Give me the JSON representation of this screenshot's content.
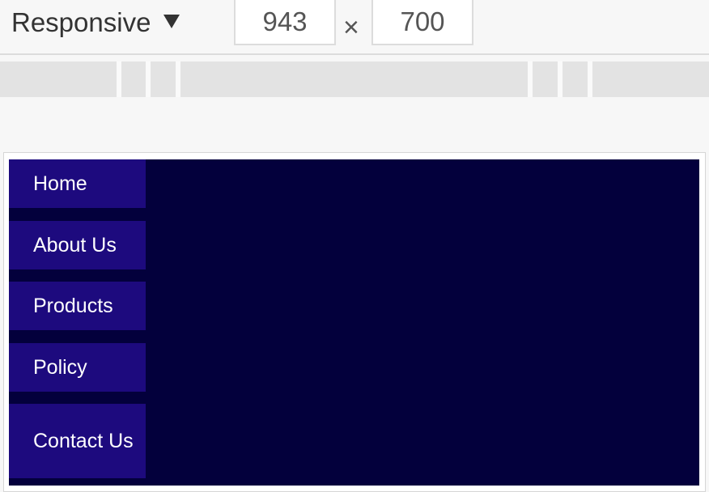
{
  "toolbar": {
    "device_label": "Responsive",
    "width_value": "943",
    "height_value": "700",
    "times_symbol": "×"
  },
  "nav": {
    "items": [
      {
        "label": "Home"
      },
      {
        "label": "About Us"
      },
      {
        "label": "Products"
      },
      {
        "label": "Policy"
      },
      {
        "label": "Contact Us"
      }
    ]
  },
  "colors": {
    "page_background": "#03003c",
    "nav_item_background": "#1d0a7e",
    "nav_text": "#ffffff"
  }
}
